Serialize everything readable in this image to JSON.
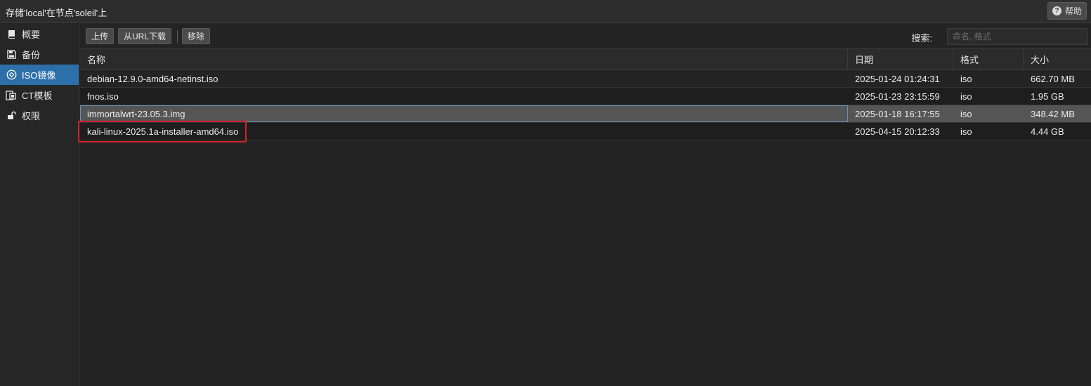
{
  "window": {
    "title": "存储'local'在节点'soleil'上",
    "help_label": "帮助",
    "help_icon": "question-circle-icon"
  },
  "sidebar": {
    "items": [
      {
        "label": "概要",
        "icon": "book-icon",
        "active": false
      },
      {
        "label": "备份",
        "icon": "floppy-disk-icon",
        "active": false
      },
      {
        "label": "ISO镜像",
        "icon": "disc-icon",
        "active": true
      },
      {
        "label": "CT模板",
        "icon": "container-template-icon",
        "active": false
      },
      {
        "label": "权限",
        "icon": "unlock-icon",
        "active": false
      }
    ]
  },
  "toolbar": {
    "upload_label": "上传",
    "download_url_label": "从URL下载",
    "remove_label": "移除",
    "search_label": "搜索:",
    "search_placeholder": "命名, 格式",
    "search_value": ""
  },
  "table": {
    "columns": [
      "名称",
      "日期",
      "格式",
      "大小"
    ],
    "rows": [
      {
        "name": "debian-12.9.0-amd64-netinst.iso",
        "date": "2025-01-24 01:24:31",
        "format": "iso",
        "size": "662.70 MB"
      },
      {
        "name": "fnos.iso",
        "date": "2025-01-23 23:15:59",
        "format": "iso",
        "size": "1.95 GB"
      },
      {
        "name": "immortalwrt-23.05.3.img",
        "date": "2025-01-18 16:17:55",
        "format": "iso",
        "size": "348.42 MB"
      },
      {
        "name": "kali-linux-2025.1a-installer-amd64.iso",
        "date": "2025-04-15 20:12:33",
        "format": "iso",
        "size": "4.44 GB"
      }
    ],
    "selected_row_index": 2,
    "highlighted_row_index": 3
  },
  "colors": {
    "accent": "#2d6fa9",
    "highlight_box": "#d3222a",
    "selected_row": "#555555"
  }
}
